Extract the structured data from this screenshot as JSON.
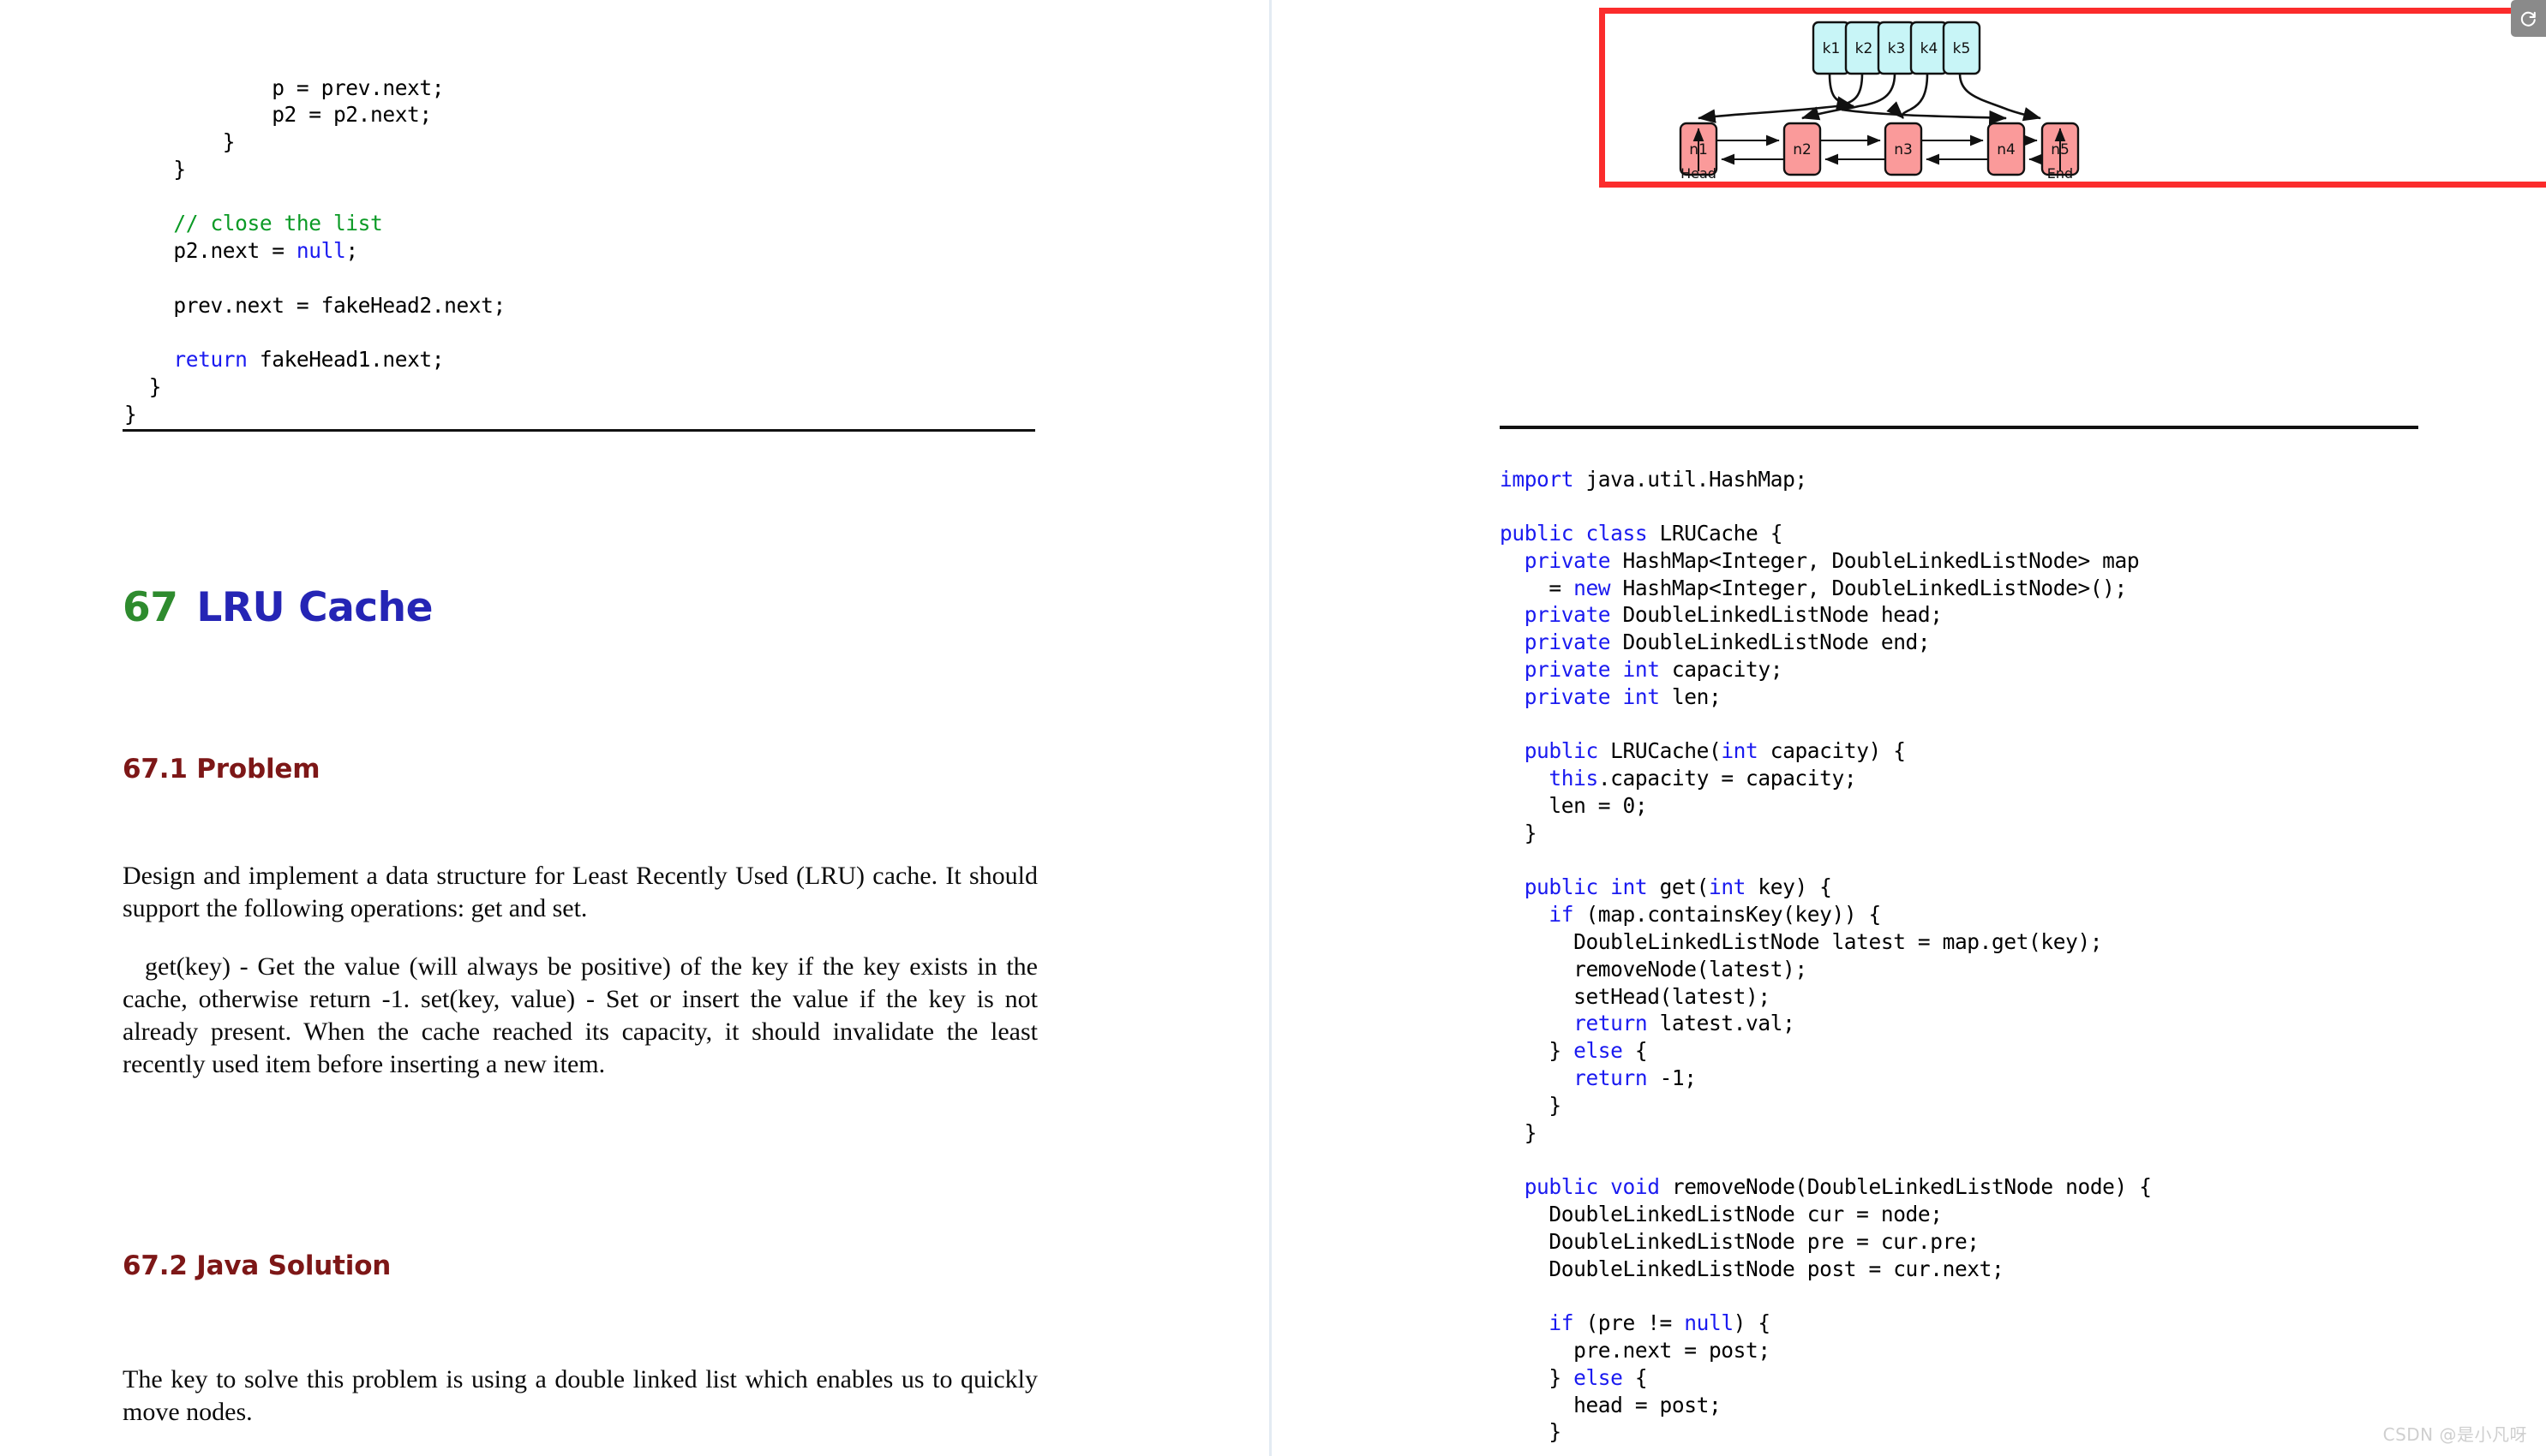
{
  "left_column": {
    "code_top": {
      "lines": [
        [
          {
            "t": "            p = prev.next;",
            "c": "plain"
          }
        ],
        [
          {
            "t": "            p2 = p2.next;",
            "c": "plain"
          }
        ],
        [
          {
            "t": "        }",
            "c": "plain"
          }
        ],
        [
          {
            "t": "    }",
            "c": "plain"
          }
        ],
        [
          {
            "t": "",
            "c": "plain"
          }
        ],
        [
          {
            "t": "    ",
            "c": "plain"
          },
          {
            "t": "// close the list",
            "c": "cmt"
          }
        ],
        [
          {
            "t": "    p2.next = ",
            "c": "plain"
          },
          {
            "t": "null",
            "c": "kw"
          },
          {
            "t": ";",
            "c": "plain"
          }
        ],
        [
          {
            "t": "",
            "c": "plain"
          }
        ],
        [
          {
            "t": "    prev.next = fakeHead2.next;",
            "c": "plain"
          }
        ],
        [
          {
            "t": "",
            "c": "plain"
          }
        ],
        [
          {
            "t": "    ",
            "c": "plain"
          },
          {
            "t": "return",
            "c": "kw"
          },
          {
            "t": " fakeHead1.next;",
            "c": "plain"
          }
        ],
        [
          {
            "t": "  }",
            "c": "plain"
          }
        ],
        [
          {
            "t": "}",
            "c": "plain"
          }
        ]
      ]
    },
    "chapter_number": "67",
    "chapter_title": "LRU Cache",
    "section_problem": "67.1  Problem",
    "section_solution": "67.2  Java Solution",
    "paragraph_1": "Design and implement a data structure for Least Recently Used (LRU) cache. It should support the following operations: get and set.",
    "paragraph_2": "get(key) - Get the value (will always be positive) of the key if the key exists in the cache, otherwise return -1.  set(key, value) - Set or insert the value if the key is not already present.  When the cache reached its capacity, it should invalidate the least recently used item before inserting a new item.",
    "paragraph_3": "The key to solve this problem is using a double linked list which enables us to quickly move nodes."
  },
  "right_column": {
    "diagram": {
      "border_color": "#fb2c2c",
      "key_box_fill": "#c8f5f7",
      "node_box_fill": "#fa9a9a",
      "box_stroke": "#111111",
      "keys": [
        "k1",
        "k2",
        "k3",
        "k4",
        "k5"
      ],
      "nodes": [
        "n1",
        "n2",
        "n3",
        "n4",
        "n5"
      ],
      "head_label": "Head",
      "end_label": "End",
      "key_to_node_links": [
        {
          "from": "k1",
          "to": "n2"
        },
        {
          "from": "k2",
          "to": "n1"
        },
        {
          "from": "k3",
          "to": "n4"
        },
        {
          "from": "k4",
          "to": "n3"
        },
        {
          "from": "k5",
          "to": "n5"
        }
      ],
      "node_links_bidirectional": [
        {
          "from": "n1",
          "to": "n2"
        },
        {
          "from": "n2",
          "to": "n3"
        },
        {
          "from": "n3",
          "to": "n4"
        },
        {
          "from": "n4",
          "to": "n5"
        }
      ]
    },
    "code_main": {
      "lines": [
        [
          {
            "t": "import",
            "c": "kw"
          },
          {
            "t": " java.util.HashMap;",
            "c": "plain"
          }
        ],
        [
          {
            "t": "",
            "c": "plain"
          }
        ],
        [
          {
            "t": "public class",
            "c": "kw"
          },
          {
            "t": " LRUCache {",
            "c": "plain"
          }
        ],
        [
          {
            "t": "  ",
            "c": "plain"
          },
          {
            "t": "private",
            "c": "kw"
          },
          {
            "t": " HashMap<Integer, DoubleLinkedListNode> map",
            "c": "plain"
          }
        ],
        [
          {
            "t": "    = ",
            "c": "plain"
          },
          {
            "t": "new",
            "c": "kw"
          },
          {
            "t": " HashMap<Integer, DoubleLinkedListNode>();",
            "c": "plain"
          }
        ],
        [
          {
            "t": "  ",
            "c": "plain"
          },
          {
            "t": "private",
            "c": "kw"
          },
          {
            "t": " DoubleLinkedListNode head;",
            "c": "plain"
          }
        ],
        [
          {
            "t": "  ",
            "c": "plain"
          },
          {
            "t": "private",
            "c": "kw"
          },
          {
            "t": " DoubleLinkedListNode end;",
            "c": "plain"
          }
        ],
        [
          {
            "t": "  ",
            "c": "plain"
          },
          {
            "t": "private int",
            "c": "kw"
          },
          {
            "t": " capacity;",
            "c": "plain"
          }
        ],
        [
          {
            "t": "  ",
            "c": "plain"
          },
          {
            "t": "private int",
            "c": "kw"
          },
          {
            "t": " len;",
            "c": "plain"
          }
        ],
        [
          {
            "t": "",
            "c": "plain"
          }
        ],
        [
          {
            "t": "  ",
            "c": "plain"
          },
          {
            "t": "public",
            "c": "kw"
          },
          {
            "t": " LRUCache(",
            "c": "plain"
          },
          {
            "t": "int",
            "c": "kw"
          },
          {
            "t": " capacity) {",
            "c": "plain"
          }
        ],
        [
          {
            "t": "    ",
            "c": "plain"
          },
          {
            "t": "this",
            "c": "kw"
          },
          {
            "t": ".capacity = capacity;",
            "c": "plain"
          }
        ],
        [
          {
            "t": "    len = 0;",
            "c": "plain"
          }
        ],
        [
          {
            "t": "  }",
            "c": "plain"
          }
        ],
        [
          {
            "t": "",
            "c": "plain"
          }
        ],
        [
          {
            "t": "  ",
            "c": "plain"
          },
          {
            "t": "public int",
            "c": "kw"
          },
          {
            "t": " get(",
            "c": "plain"
          },
          {
            "t": "int",
            "c": "kw"
          },
          {
            "t": " key) {",
            "c": "plain"
          }
        ],
        [
          {
            "t": "    ",
            "c": "plain"
          },
          {
            "t": "if",
            "c": "kw"
          },
          {
            "t": " (map.containsKey(key)) {",
            "c": "plain"
          }
        ],
        [
          {
            "t": "      DoubleLinkedListNode latest = map.get(key);",
            "c": "plain"
          }
        ],
        [
          {
            "t": "      removeNode(latest);",
            "c": "plain"
          }
        ],
        [
          {
            "t": "      setHead(latest);",
            "c": "plain"
          }
        ],
        [
          {
            "t": "      ",
            "c": "plain"
          },
          {
            "t": "return",
            "c": "kw"
          },
          {
            "t": " latest.val;",
            "c": "plain"
          }
        ],
        [
          {
            "t": "    } ",
            "c": "plain"
          },
          {
            "t": "else",
            "c": "kw"
          },
          {
            "t": " {",
            "c": "plain"
          }
        ],
        [
          {
            "t": "      ",
            "c": "plain"
          },
          {
            "t": "return",
            "c": "kw"
          },
          {
            "t": " -1;",
            "c": "plain"
          }
        ],
        [
          {
            "t": "    }",
            "c": "plain"
          }
        ],
        [
          {
            "t": "  }",
            "c": "plain"
          }
        ],
        [
          {
            "t": "",
            "c": "plain"
          }
        ],
        [
          {
            "t": "  ",
            "c": "plain"
          },
          {
            "t": "public void",
            "c": "kw"
          },
          {
            "t": " removeNode(DoubleLinkedListNode node) {",
            "c": "plain"
          }
        ],
        [
          {
            "t": "    DoubleLinkedListNode cur = node;",
            "c": "plain"
          }
        ],
        [
          {
            "t": "    DoubleLinkedListNode pre = cur.pre;",
            "c": "plain"
          }
        ],
        [
          {
            "t": "    DoubleLinkedListNode post = cur.next;",
            "c": "plain"
          }
        ],
        [
          {
            "t": "",
            "c": "plain"
          }
        ],
        [
          {
            "t": "    ",
            "c": "plain"
          },
          {
            "t": "if",
            "c": "kw"
          },
          {
            "t": " (pre != ",
            "c": "plain"
          },
          {
            "t": "null",
            "c": "kw"
          },
          {
            "t": ") {",
            "c": "plain"
          }
        ],
        [
          {
            "t": "      pre.next = post;",
            "c": "plain"
          }
        ],
        [
          {
            "t": "    } ",
            "c": "plain"
          },
          {
            "t": "else",
            "c": "kw"
          },
          {
            "t": " {",
            "c": "plain"
          }
        ],
        [
          {
            "t": "      head = post;",
            "c": "plain"
          }
        ],
        [
          {
            "t": "    }",
            "c": "plain"
          }
        ]
      ]
    }
  },
  "overlays": {
    "reload_icon": "reload-icon",
    "watermark": "CSDN @是小凡呀"
  }
}
